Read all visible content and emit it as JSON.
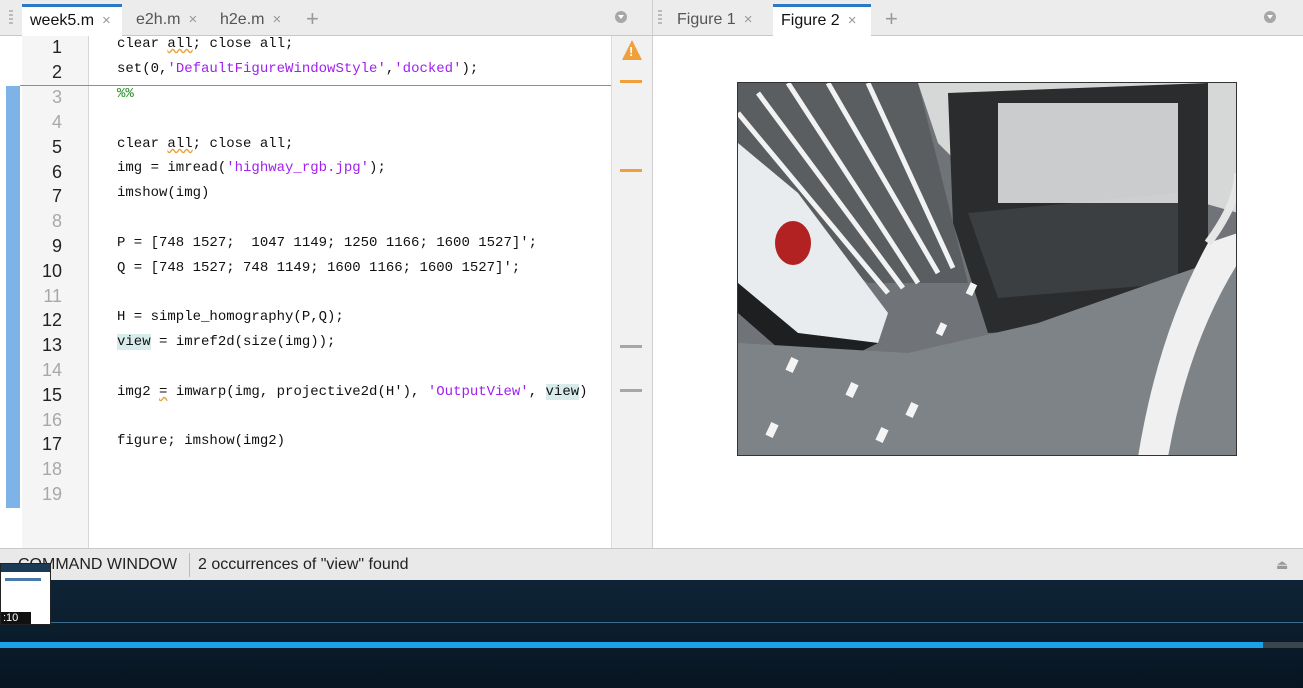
{
  "editor": {
    "tabs": [
      {
        "label": "week5.m",
        "close": "×",
        "active": true
      },
      {
        "label": "e2h.m",
        "close": "×",
        "active": false
      },
      {
        "label": "h2e.m",
        "close": "×",
        "active": false
      }
    ],
    "add_tab": "+",
    "warning_glyph": "!",
    "lines": [
      {
        "n": "1"
      },
      {
        "n": "2"
      },
      {
        "n": "3"
      },
      {
        "n": "4"
      },
      {
        "n": "5"
      },
      {
        "n": "6"
      },
      {
        "n": "7"
      },
      {
        "n": "8"
      },
      {
        "n": "9"
      },
      {
        "n": "10"
      },
      {
        "n": "11"
      },
      {
        "n": "12"
      },
      {
        "n": "13"
      },
      {
        "n": "14"
      },
      {
        "n": "15"
      },
      {
        "n": "16"
      },
      {
        "n": "17"
      },
      {
        "n": "18"
      },
      {
        "n": "19"
      }
    ],
    "code": {
      "l1a": "clear ",
      "l1b": "all",
      "l1c": "; close all;",
      "l2a": "set(0,",
      "l2b": "'DefaultFigureWindowStyle'",
      "l2c": ",",
      "l2d": "'docked'",
      "l2e": ");",
      "l3": "%%",
      "l5a": "clear ",
      "l5b": "all",
      "l5c": "; close all;",
      "l6a": "img = imread(",
      "l6b": "'highway_rgb.jpg'",
      "l6c": ");",
      "l7": "imshow(img)",
      "l9": "P = [748 1527;  1047 1149; 1250 1166; 1600 1527]';",
      "l10": "Q = [748 1527; 748 1149; 1600 1166; 1600 1527]';",
      "l12": "H = simple_homography(P,Q);",
      "l13a": "view",
      "l13b": " = imref2d(size(img));",
      "l15a": "img2 ",
      "l15b": "=",
      "l15c": " imwarp(img, projective2d(H'), ",
      "l15d": "'OutputView'",
      "l15e": ", ",
      "l15f": "view",
      "l15g": ")",
      "l17": "figure; imshow(img2)"
    }
  },
  "figures": {
    "tabs": [
      {
        "label": "Figure 1",
        "close": "×",
        "active": false
      },
      {
        "label": "Figure 2",
        "close": "×",
        "active": true
      }
    ],
    "add_tab": "+"
  },
  "command_window": {
    "label": "COMMAND WINDOW",
    "status": "2 occurrences of \"view\" found"
  },
  "video": {
    "timestamp": ":10",
    "progress_fraction": 0.969
  },
  "colors": {
    "accent": "#2b78c5",
    "string": "#a020f0",
    "comment": "#228b22",
    "warning": "#f0a03a",
    "progress": "#1aa3e8"
  }
}
